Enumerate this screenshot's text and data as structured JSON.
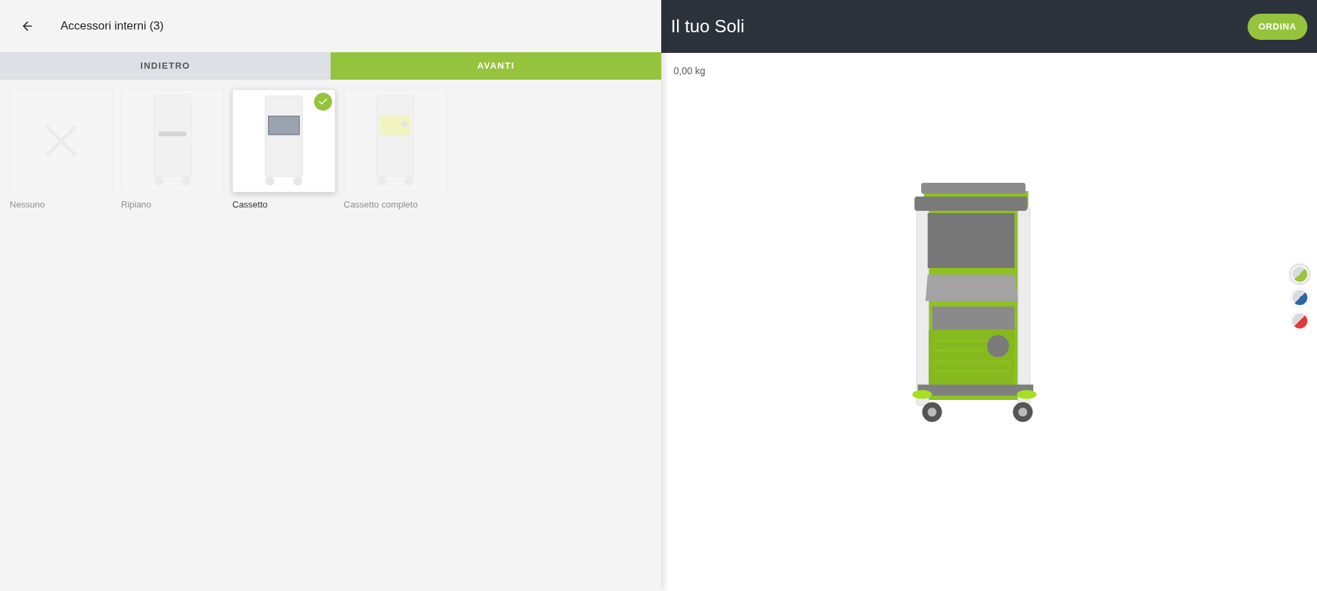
{
  "header": {
    "title": "Accessori interni (3)"
  },
  "nav": {
    "back": "INDIETRO",
    "next": "AVANTI"
  },
  "options": [
    {
      "kind": "none",
      "label": "Nessuno",
      "selected": false
    },
    {
      "kind": "shelf",
      "label": "Ripiano",
      "selected": false
    },
    {
      "kind": "drawer",
      "label": "Cassetto",
      "selected": true
    },
    {
      "kind": "full_drawer",
      "label": "Cassetto completo",
      "selected": false
    }
  ],
  "preview": {
    "title": "Il tuo Soli",
    "order_button": "ORDINA",
    "weight": "0,00 kg"
  },
  "colors": [
    {
      "color": "#9bc53d",
      "selected": true
    },
    {
      "color": "#2f64a8",
      "selected": false
    },
    {
      "color": "#e03a3a",
      "selected": false
    }
  ]
}
